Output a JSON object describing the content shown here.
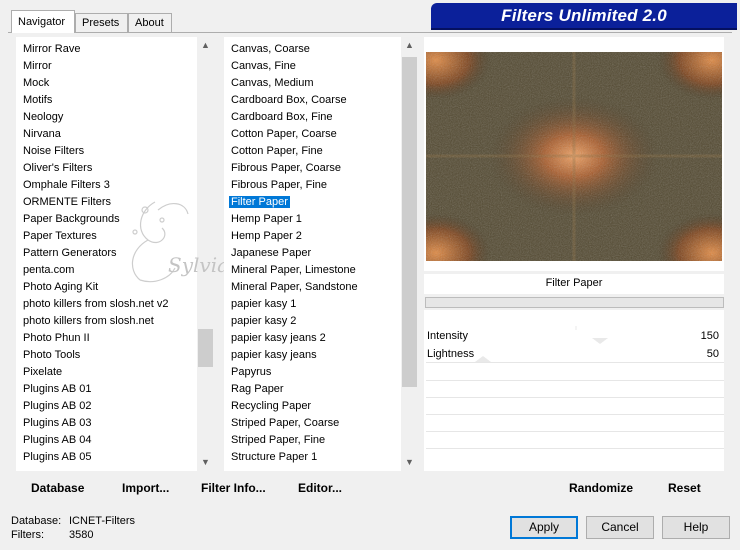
{
  "tabs": [
    "Navigator",
    "Presets",
    "About"
  ],
  "banner_title": "Filters Unlimited 2.0",
  "watermark": "Sylviane",
  "categories": [
    "Mirror Rave",
    "Mirror",
    "Mock",
    "Motifs",
    "Neology",
    "Nirvana",
    "Noise Filters",
    "Oliver's Filters",
    "Omphale Filters 3",
    "ORMENTE Filters",
    "Paper Backgrounds",
    "Paper Textures",
    "Pattern Generators",
    "penta.com",
    "Photo Aging Kit",
    "photo killers from slosh.net v2",
    "photo killers from slosh.net",
    "Photo Phun II",
    "Photo Tools",
    "Pixelate",
    "Plugins AB 01",
    "Plugins AB 02",
    "Plugins AB 03",
    "Plugins AB 04",
    "Plugins AB 05"
  ],
  "filters": [
    "Canvas, Coarse",
    "Canvas, Fine",
    "Canvas, Medium",
    "Cardboard Box, Coarse",
    "Cardboard Box, Fine",
    "Cotton Paper, Coarse",
    "Cotton Paper, Fine",
    "Fibrous Paper, Coarse",
    "Fibrous Paper, Fine",
    "Filter Paper",
    "Hemp Paper 1",
    "Hemp Paper 2",
    "Japanese Paper",
    "Mineral Paper, Limestone",
    "Mineral Paper, Sandstone",
    "papier kasy 1",
    "papier kasy 2",
    "papier kasy jeans 2",
    "papier kasy jeans",
    "Papyrus",
    "Rag Paper",
    "Recycling Paper",
    "Striped Paper, Coarse",
    "Striped Paper, Fine",
    "Structure Paper 1"
  ],
  "selected_filter": "Filter Paper",
  "filter_name": "Filter Paper",
  "sliders": [
    {
      "label": "Intensity",
      "value": "150",
      "max": 255
    },
    {
      "label": "Lightness",
      "value": "50",
      "max": 255
    }
  ],
  "toolbar": {
    "database": "Database",
    "database_u": "D",
    "import": "Import...",
    "import_u": "I",
    "filter_info": "Filter Info...",
    "filter_info_u": "F",
    "editor": "Editor...",
    "editor_u": "E",
    "randomize": "Randomize",
    "reset": "Reset"
  },
  "status": {
    "database_label": "Database:",
    "database_value": "ICNET-Filters",
    "filters_label": "Filters:",
    "filters_value": "3580"
  },
  "buttons": {
    "apply": "Apply",
    "cancel": "Cancel",
    "help": "Help"
  },
  "colors": {
    "banner": "#0b209a",
    "selection": "#0078d7"
  }
}
